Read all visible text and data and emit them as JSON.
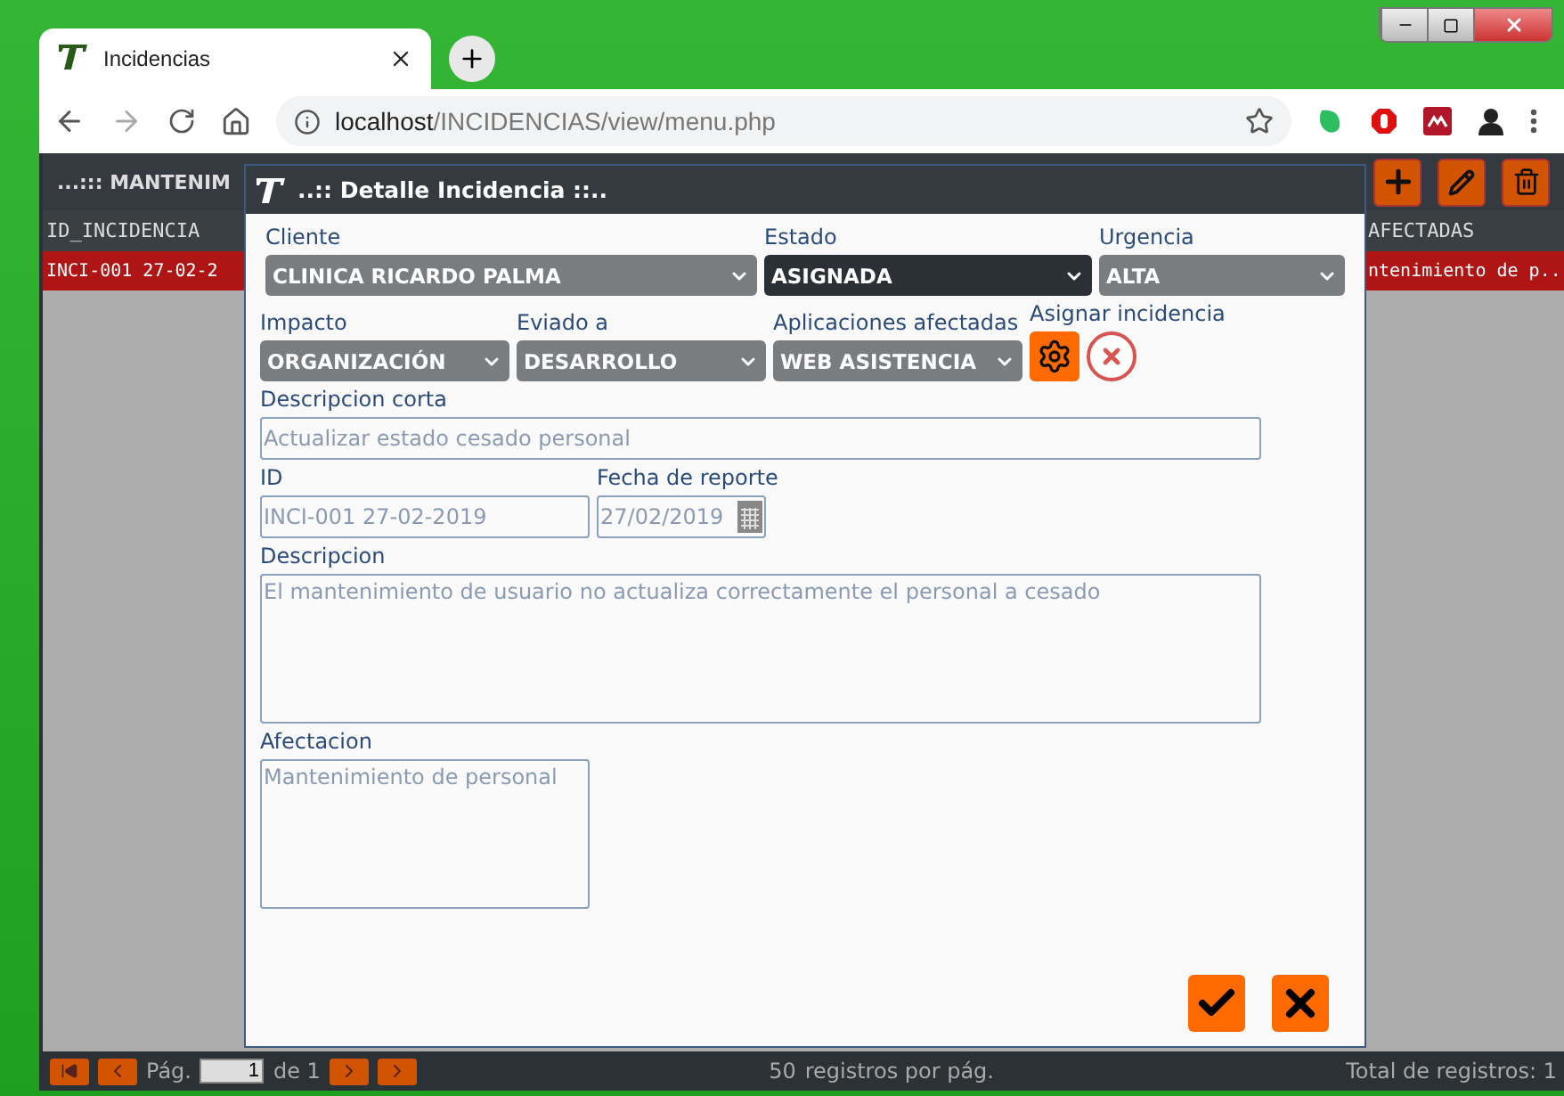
{
  "browser": {
    "tab_title": "Incidencias",
    "url_host": "localhost",
    "url_path": "/INCIDENCIAS/view/menu.php"
  },
  "page": {
    "header_title": "...::: MANTENIM",
    "table": {
      "columns": [
        "ID_INCIDENCIA",
        "AFECTADAS"
      ],
      "rows": [
        {
          "cells": [
            "INCI-001 27-02-2",
            "ntenimiento de p..."
          ],
          "selected": true
        }
      ]
    },
    "pager": {
      "page_label": "Pág.",
      "page": "1",
      "of_label": "de 1",
      "per_page": "50",
      "per_page_label": "registros por pág.",
      "total": "Total de registros: 1"
    }
  },
  "dialog": {
    "title": "..:: Detalle Incidencia ::..",
    "row_1": [
      {
        "label": "Cliente",
        "value": "CLINICA RICARDO PALMA",
        "focused": false
      },
      {
        "label": "Estado",
        "value": "ASIGNADA",
        "focused": true
      },
      {
        "label": "Urgencia",
        "value": "ALTA",
        "focused": false
      }
    ],
    "row_2": [
      {
        "label": "Impacto",
        "value": "ORGANIZACIÓN",
        "focused": false
      },
      {
        "label": "Eviado a",
        "value": "DESARROLLO",
        "focused": false
      },
      {
        "label": "Aplicaciones afectadas",
        "value": "WEB ASISTENCIA",
        "focused": false
      }
    ],
    "assign_label": "Asignar incidencia",
    "short_description": {
      "label": "Descripcion corta",
      "value": "Actualizar estado cesado personal"
    },
    "id": {
      "label": "ID",
      "value": "INCI-001 27-02-2019"
    },
    "report_date": {
      "label": "Fecha de reporte",
      "value": "27/02/2019"
    },
    "description": {
      "label": "Descripcion",
      "value": "El mantenimiento de usuario no actualiza correctamente el personal a cesado"
    },
    "affectation": {
      "label": "Afectacion",
      "value": "Mantenimiento de personal"
    }
  }
}
